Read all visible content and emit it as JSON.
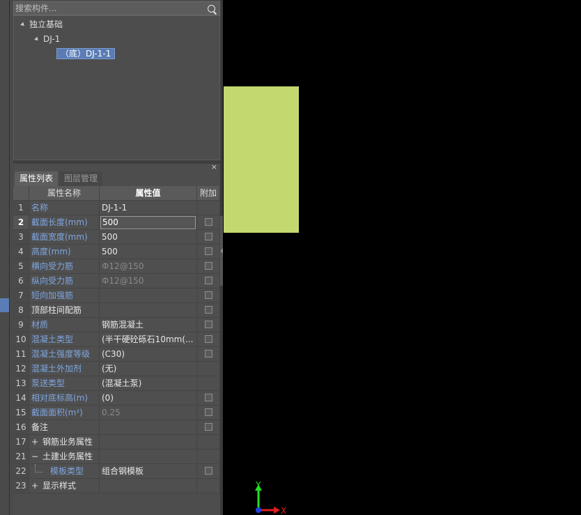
{
  "search": {
    "placeholder": "搜索构件..."
  },
  "tree": {
    "root": "独立基础",
    "child": "DJ-1",
    "leaf": "（底）DJ-1-1"
  },
  "tabs": [
    "属性列表",
    "图层管理"
  ],
  "grid": {
    "headers": {
      "name": "属性名称",
      "value": "属性值",
      "extra": "附加"
    },
    "rows": [
      {
        "num": "1",
        "name": "名称",
        "value": "DJ-1-1"
      },
      {
        "num": "2",
        "name": "截面长度(mm)",
        "value": "500"
      },
      {
        "num": "3",
        "name": "截面宽度(mm)",
        "value": "500"
      },
      {
        "num": "4",
        "name": "高度(mm)",
        "value": "500"
      },
      {
        "num": "5",
        "name": "横向受力筋",
        "value": "Ф12@150"
      },
      {
        "num": "6",
        "name": "纵向受力筋",
        "value": "Ф12@150"
      },
      {
        "num": "7",
        "name": "短向加强筋",
        "value": ""
      },
      {
        "num": "8",
        "name": "顶部柱间配筋",
        "value": ""
      },
      {
        "num": "9",
        "name": "材质",
        "value": "钢筋混凝土"
      },
      {
        "num": "10",
        "name": "混凝土类型",
        "value": "(半干硬砼砾石10mm(..."
      },
      {
        "num": "11",
        "name": "混凝土强度等级",
        "value": "(C30)"
      },
      {
        "num": "12",
        "name": "混凝土外加剂",
        "value": "(无)"
      },
      {
        "num": "13",
        "name": "泵送类型",
        "value": "(混凝土泵)"
      },
      {
        "num": "14",
        "name": "相对底标高(m)",
        "value": "(0)"
      },
      {
        "num": "15",
        "name": "截面面积(m²)",
        "value": "0.25"
      },
      {
        "num": "16",
        "name": "备注",
        "value": ""
      },
      {
        "num": "17",
        "name": "钢筋业务属性",
        "value": ""
      },
      {
        "num": "21",
        "name": "土建业务属性",
        "value": ""
      },
      {
        "num": "22",
        "name": "模板类型",
        "value": "组合钢模板"
      },
      {
        "num": "23",
        "name": "显示样式",
        "value": ""
      }
    ]
  },
  "panel": {
    "close_icon": "×"
  },
  "expanders": {
    "expand": "+",
    "collapse": "−"
  },
  "axis": {
    "x_label": "X",
    "y_label": "Y"
  },
  "colors": {
    "accent": "#5b7db5",
    "canvas": "#000000",
    "element_fill": "#c3d970"
  }
}
